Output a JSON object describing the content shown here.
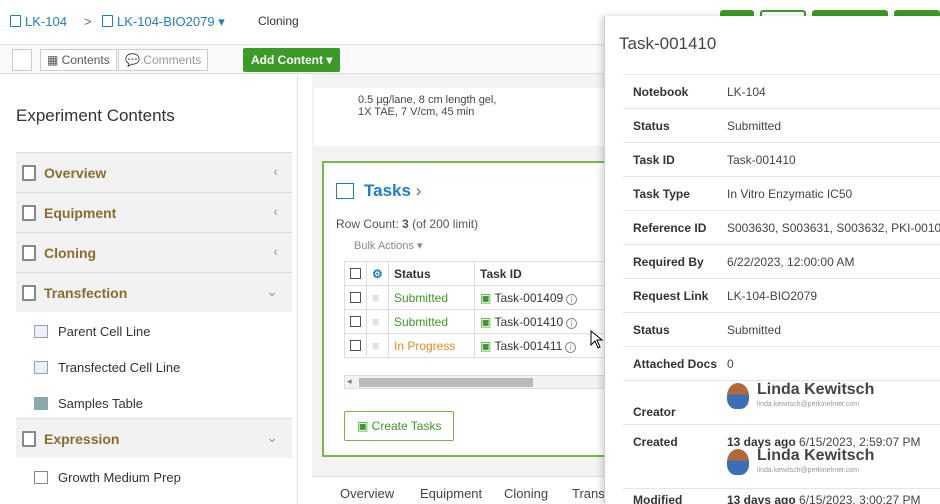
{
  "breadcrumb": {
    "notebook": "LK-104",
    "separator": ">",
    "experiment": "LK-104-BIO2079",
    "section": "Cloning"
  },
  "toolbar": {
    "contents_label": "Contents",
    "comments_label": "Comments",
    "add_content_label": "Add Content ▾"
  },
  "sidebar": {
    "title": "Experiment Contents",
    "sections": [
      {
        "label": "Overview",
        "chevron": "‹"
      },
      {
        "label": "Equipment",
        "chevron": "‹"
      },
      {
        "label": "Cloning",
        "chevron": "‹"
      },
      {
        "label": "Transfection",
        "chevron": "⌄"
      },
      {
        "label": "Expression",
        "chevron": "⌄"
      }
    ],
    "transfection_items": [
      "Parent Cell Line",
      "Transfected Cell Line",
      "Samples Table"
    ],
    "expression_items": [
      "Growth Medium Prep"
    ]
  },
  "main": {
    "note_line1": "0.5 µg/lane, 8 cm length gel,",
    "note_line2": "1X TAE, 7 V/cm, 45 min",
    "tasks_title": "Tasks",
    "row_count_label": "Row Count:",
    "row_count_value": "3",
    "row_count_limit": "(of 200 limit)",
    "bulk_actions": "Bulk Actions ▾",
    "table": {
      "headers": [
        "Status",
        "Task ID"
      ],
      "rows": [
        {
          "status": "Submitted",
          "task_id": "Task-001409"
        },
        {
          "status": "Submitted",
          "task_id": "Task-001410"
        },
        {
          "status": "In Progress",
          "task_id": "Task-001411"
        }
      ]
    },
    "create_tasks_label": "Create Tasks"
  },
  "tabs": [
    "Overview",
    "Equipment",
    "Cloning",
    "Trans"
  ],
  "popover": {
    "title": "Task-001410",
    "fields": [
      {
        "key": "Notebook",
        "value": "LK-104"
      },
      {
        "key": "Status",
        "value": "Submitted"
      },
      {
        "key": "Task ID",
        "value": "Task-001410"
      },
      {
        "key": "Task Type",
        "value": "In Vitro Enzymatic IC50"
      },
      {
        "key": "Reference ID",
        "value": "S003630, S003631, S003632, PKI-0010"
      },
      {
        "key": "Required By",
        "value": "6/22/2023, 12:00:00 AM"
      },
      {
        "key": "Request Link",
        "value": "LK-104-BIO2079"
      },
      {
        "key": "Status",
        "value": "Submitted"
      },
      {
        "key": "Attached Docs",
        "value": "0"
      }
    ],
    "creator_label": "Creator",
    "creator_name": "Linda Kewitsch",
    "creator_email": "linda.kewitsch@perkinelmer.com",
    "created_label": "Created",
    "created_ago": "13 days ago",
    "created_date": "6/15/2023, 2:59:07 PM",
    "created_name": "Linda Kewitsch",
    "created_email": "linda.kewitsch@perkinelmer.com",
    "modified_label": "Modified",
    "modified_ago": "13 days ago",
    "modified_date": "6/15/2023, 3:00:27 PM"
  },
  "colors": {
    "accent_green": "#3c9a26",
    "link_blue": "#1f7fc0",
    "in_progress": "#e58a1f",
    "section_label": "#8a6d2e"
  }
}
